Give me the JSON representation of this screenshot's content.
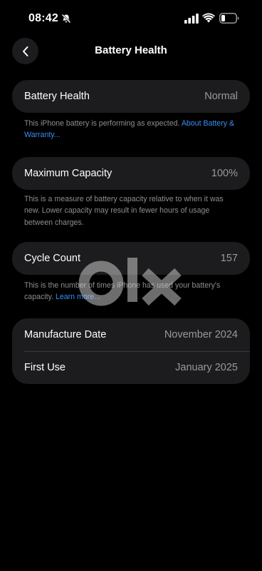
{
  "status_bar": {
    "time": "08:42",
    "icons": [
      "bell-slash-icon",
      "cellular-signal-icon",
      "wifi-icon",
      "battery-icon"
    ]
  },
  "nav": {
    "back_icon": "chevron-left-icon",
    "title": "Battery Health"
  },
  "battery_health": {
    "label": "Battery Health",
    "value": "Normal",
    "note": "This iPhone battery is performing as expected.",
    "link": "About Battery & Warranty..."
  },
  "maximum_capacity": {
    "label": "Maximum Capacity",
    "value": "100%",
    "note": "This is a measure of battery capacity relative to when it was new. Lower capacity may result in fewer hours of usage between charges."
  },
  "cycle_count": {
    "label": "Cycle Count",
    "value": "157",
    "note": "This is the number of times iPhone has used your battery's capacity.",
    "link": "Learn more..."
  },
  "dates": {
    "manufacture_label": "Manufacture Date",
    "manufacture_value": "November 2024",
    "first_use_label": "First Use",
    "first_use_value": "January 2025"
  },
  "watermark": {
    "logo": "olx"
  },
  "colors": {
    "background": "#000000",
    "card": "#1c1c1e",
    "secondary_text": "#98989f",
    "footnote_text": "#8e8e93",
    "link": "#3a8ef6"
  }
}
